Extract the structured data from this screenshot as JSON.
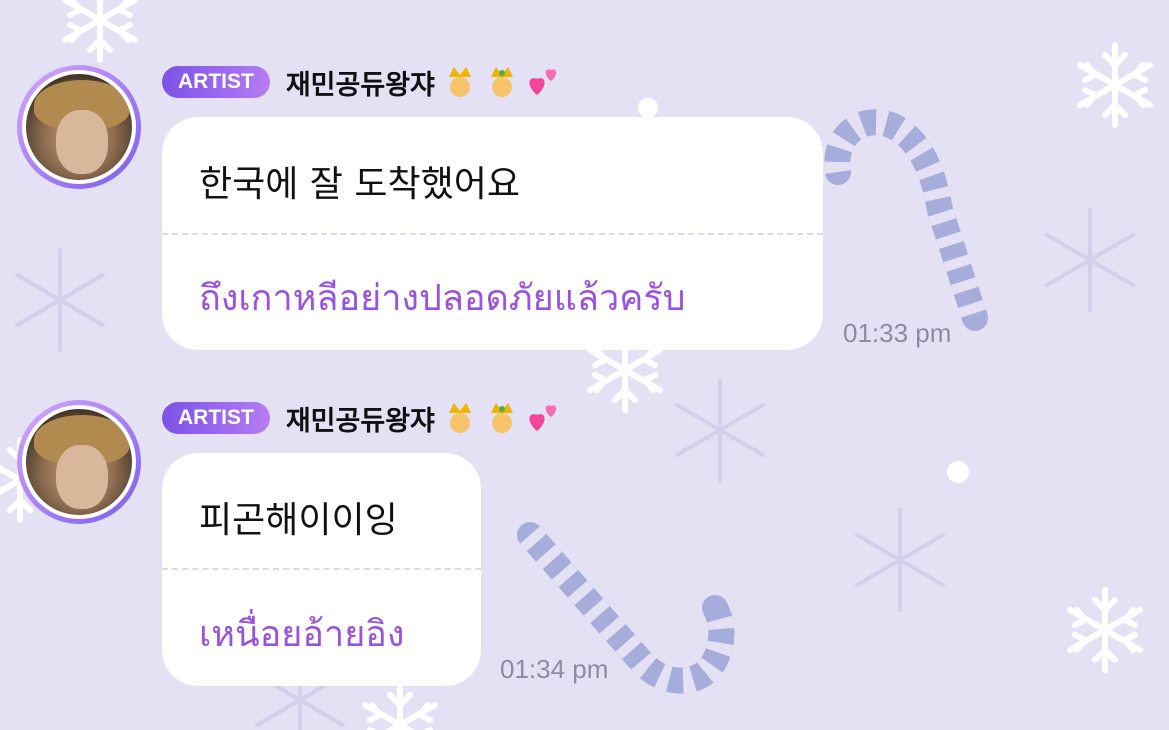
{
  "colors": {
    "background": "#e3e1f3",
    "badge_start": "#7d52e6",
    "badge_end": "#b57cf4",
    "translation_text": "#9a52e0",
    "timestamp": "#8f8aa3"
  },
  "messages": [
    {
      "badge": "ARTIST",
      "sender": "재민공듀왕쟈",
      "sender_emojis": [
        "prince-crown-icon",
        "prince-crown-icon",
        "two-hearts-icon"
      ],
      "text": "한국에 잘 도착했어요",
      "translation": "ถึงเกาหลีอย่างปลอดภัยแล้วครับ",
      "time": "01:33 pm"
    },
    {
      "badge": "ARTIST",
      "sender": "재민공듀왕쟈",
      "sender_emojis": [
        "prince-crown-icon",
        "prince-crown-icon",
        "two-hearts-icon"
      ],
      "text": "피곤해이이잉",
      "translation": "เหนื่อยอ้ายอิง",
      "time": "01:34 pm"
    }
  ]
}
